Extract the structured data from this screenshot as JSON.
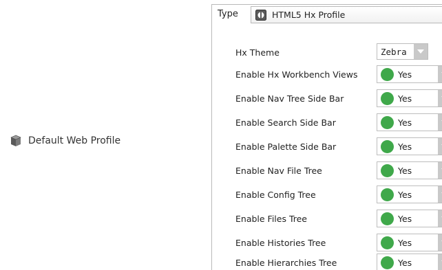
{
  "left_item": {
    "label": "Default Web Profile",
    "icon": "cube-icon"
  },
  "type_row": {
    "label": "Type",
    "value": "HTML5 Hx Profile",
    "icon": "profile-icon"
  },
  "theme": {
    "label": "Hx Theme",
    "value": "Zebra"
  },
  "settings": [
    {
      "label": "Enable Hx Workbench Views",
      "value": "Yes"
    },
    {
      "label": "Enable Nav Tree Side Bar",
      "value": "Yes"
    },
    {
      "label": "Enable Search Side Bar",
      "value": "Yes"
    },
    {
      "label": "Enable Palette Side Bar",
      "value": "Yes"
    },
    {
      "label": "Enable Nav File Tree",
      "value": "Yes"
    },
    {
      "label": "Enable Config Tree",
      "value": "Yes"
    },
    {
      "label": "Enable Files Tree",
      "value": "Yes"
    },
    {
      "label": "Enable Histories Tree",
      "value": "Yes"
    },
    {
      "label": "Enable Hierarchies Tree",
      "value": "Yes"
    }
  ],
  "colors": {
    "status_yes": "#3fa84a",
    "arrow_bg": "#c9c9c9"
  }
}
